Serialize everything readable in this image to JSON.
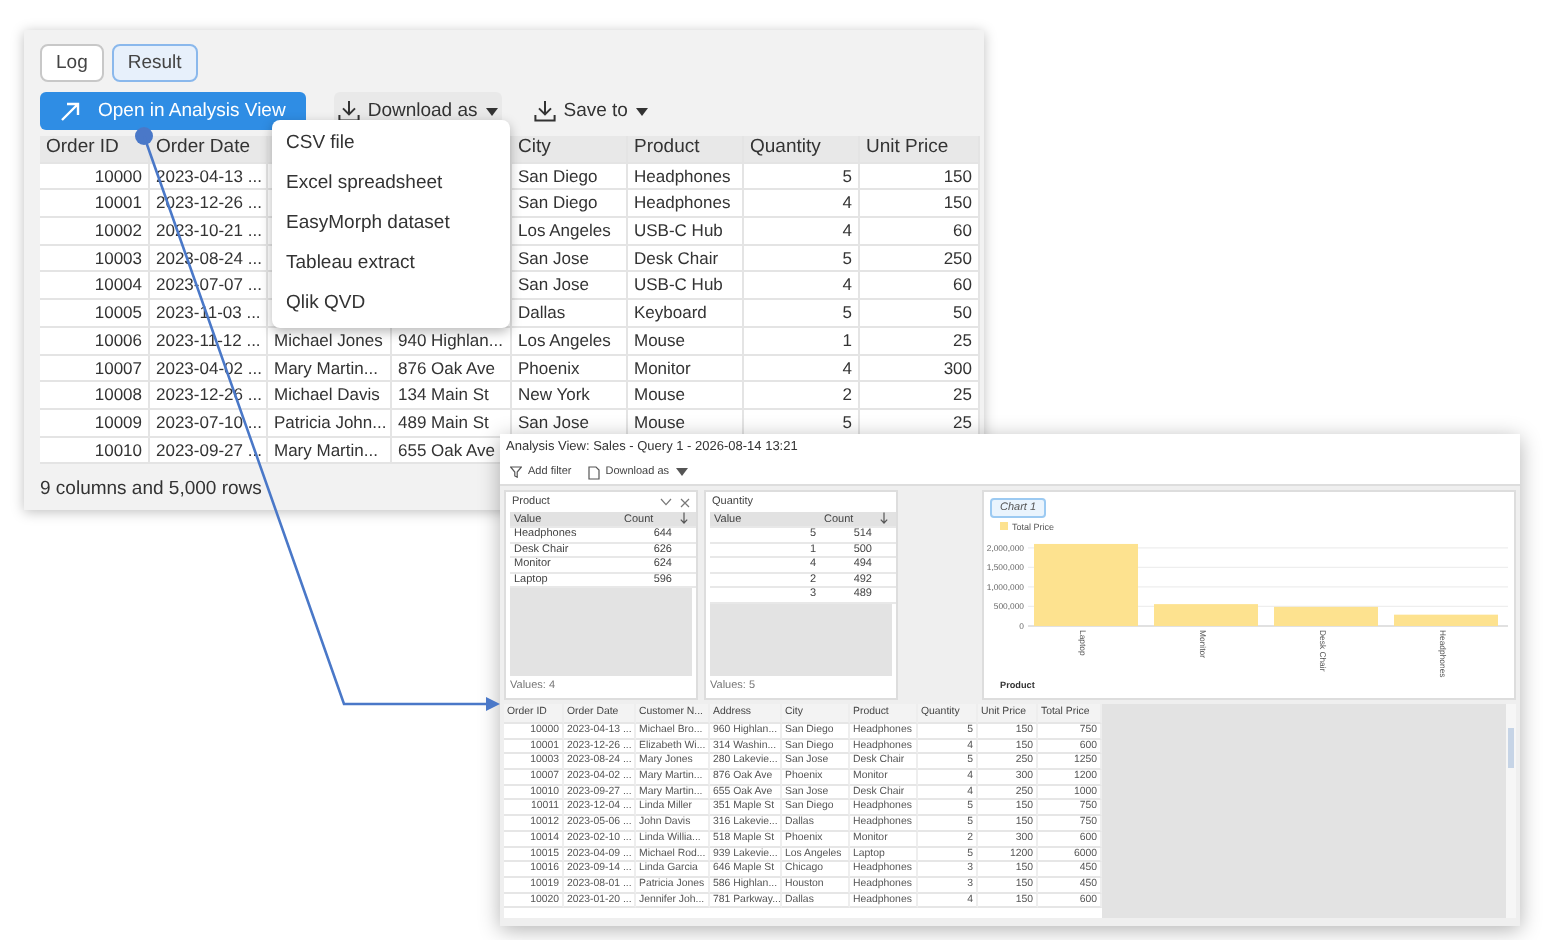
{
  "main": {
    "tabs": [
      {
        "label": "Log",
        "selected": false
      },
      {
        "label": "Result",
        "selected": true
      }
    ],
    "toolbar": {
      "open_button": "Open in Analysis View",
      "download": {
        "label": "Download as",
        "expanded": true,
        "menu": [
          "CSV file",
          "Excel spreadsheet",
          "EasyMorph dataset",
          "Tableau extract",
          "Qlik QVD"
        ]
      },
      "save": {
        "label": "Save to"
      }
    },
    "table": {
      "columns": [
        "Order ID",
        "Order Date",
        null,
        null,
        "City",
        "Product",
        "Quantity",
        "Unit Price"
      ],
      "rows": [
        [
          "10000",
          "2023-04-13 ...",
          null,
          null,
          "San Diego",
          "Headphones",
          "5",
          "150"
        ],
        [
          "10001",
          "2023-12-26 ...",
          null,
          null,
          "San Diego",
          "Headphones",
          "4",
          "150"
        ],
        [
          "10002",
          "2023-10-21 ...",
          null,
          null,
          "Los Angeles",
          "USB-C Hub",
          "4",
          "60"
        ],
        [
          "10003",
          "2023-08-24 ...",
          null,
          null,
          "San Jose",
          "Desk Chair",
          "5",
          "250"
        ],
        [
          "10004",
          "2023-07-07 ...",
          null,
          null,
          "San Jose",
          "USB-C Hub",
          "4",
          "60"
        ],
        [
          "10005",
          "2023-11-03 ...",
          null,
          null,
          "Dallas",
          "Keyboard",
          "5",
          "50"
        ],
        [
          "10006",
          "2023-11-12 ...",
          "Michael Jones",
          "940 Highlan...",
          "Los Angeles",
          "Mouse",
          "1",
          "25"
        ],
        [
          "10007",
          "2023-04-02 ...",
          "Mary Martin...",
          "876 Oak Ave",
          "Phoenix",
          "Monitor",
          "4",
          "300"
        ],
        [
          "10008",
          "2023-12-26 ...",
          "Michael Davis",
          "134 Main St",
          "New York",
          "Mouse",
          "2",
          "25"
        ],
        [
          "10009",
          "2023-07-10 ...",
          "Patricia John...",
          "489 Main St",
          "San Jose",
          "Mouse",
          "5",
          "25"
        ],
        [
          "10010",
          "2023-09-27 ...",
          "Mary Martin...",
          "655 Oak Ave"
        ]
      ]
    },
    "status_bar": "9 columns and 5,000 rows"
  },
  "analysis_window": {
    "title": "Analysis View: Sales - Query 1 - 2026-08-14 13:21",
    "toolbar": {
      "add_filter": "Add filter",
      "download": "Download as"
    },
    "filters": [
      {
        "title": "Product",
        "closable": true,
        "columns": [
          "Value",
          "Count"
        ],
        "rows": [
          [
            "Headphones",
            "644"
          ],
          [
            "Desk Chair",
            "626"
          ],
          [
            "Monitor",
            "624"
          ],
          [
            "Laptop",
            "596"
          ]
        ],
        "footer": "Values: 4"
      },
      {
        "title": "Quantity",
        "closable": false,
        "columns": [
          "Value",
          "Count"
        ],
        "rows": [
          [
            "5",
            "514"
          ],
          [
            "1",
            "500"
          ],
          [
            "4",
            "494"
          ],
          [
            "2",
            "492"
          ],
          [
            "3",
            "489"
          ]
        ],
        "footer": "Values: 5"
      }
    ],
    "chart": {
      "tab": {
        "label": "Chart 1",
        "selected": true
      },
      "chart_data": {
        "type": "bar",
        "categories": [
          "Laptop",
          "Monitor",
          "Desk Chair",
          "Headphones"
        ],
        "series": [
          {
            "name": "Total Price",
            "color": "#fde28f",
            "values": [
              2100000,
              560000,
              490000,
              290000
            ]
          }
        ],
        "xlabel": "Product",
        "grid": true,
        "ylim": [
          0,
          2150000
        ],
        "yticks": [
          0,
          {
            "value": 500000,
            "label": "500,000"
          },
          {
            "value": 1000000,
            "label": "1,000,000"
          },
          {
            "value": 1500000,
            "label": "1,500,000"
          },
          {
            "value": 2000000,
            "label": "2,000,000"
          }
        ]
      }
    },
    "table": {
      "columns": [
        "Order ID",
        "Order Date",
        "Customer N...",
        "Address",
        "City",
        "Product",
        "Quantity",
        "Unit Price",
        "Total Price"
      ],
      "rows": [
        [
          "10000",
          "2023-04-13 ...",
          "Michael Bro...",
          "960 Highlan...",
          "San Diego",
          "Headphones",
          "5",
          "150",
          "750"
        ],
        [
          "10001",
          "2023-12-26 ...",
          "Elizabeth Wi...",
          "314 Washin...",
          "San Diego",
          "Headphones",
          "4",
          "150",
          "600"
        ],
        [
          "10003",
          "2023-08-24 ...",
          "Mary Jones",
          "280 Lakevie...",
          "San Jose",
          "Desk Chair",
          "5",
          "250",
          "1250"
        ],
        [
          "10007",
          "2023-04-02 ...",
          "Mary Martin...",
          "876 Oak Ave",
          "Phoenix",
          "Monitor",
          "4",
          "300",
          "1200"
        ],
        [
          "10010",
          "2023-09-27 ...",
          "Mary Martin...",
          "655 Oak Ave",
          "San Jose",
          "Desk Chair",
          "4",
          "250",
          "1000"
        ],
        [
          "10011",
          "2023-12-04 ...",
          "Linda Miller",
          "351 Maple St",
          "San Diego",
          "Headphones",
          "5",
          "150",
          "750"
        ],
        [
          "10012",
          "2023-05-06 ...",
          "John Davis",
          "316 Lakevie...",
          "Dallas",
          "Headphones",
          "5",
          "150",
          "750"
        ],
        [
          "10014",
          "2023-02-10 ...",
          "Linda Willia...",
          "518 Maple St",
          "Phoenix",
          "Monitor",
          "2",
          "300",
          "600"
        ],
        [
          "10015",
          "2023-04-09 ...",
          "Michael Rod...",
          "939 Lakevie...",
          "Los Angeles",
          "Laptop",
          "5",
          "1200",
          "6000"
        ],
        [
          "10016",
          "2023-09-14 ...",
          "Linda Garcia",
          "646 Maple St",
          "Chicago",
          "Headphones",
          "3",
          "150",
          "450"
        ],
        [
          "10019",
          "2023-08-01 ...",
          "Patricia Jones",
          "586 Highlan...",
          "Houston",
          "Headphones",
          "3",
          "150",
          "450"
        ],
        [
          "10020",
          "2023-01-20 ...",
          "Jennifer Joh...",
          "781 Parkway...",
          "Dallas",
          "Headphones",
          "4",
          "150",
          "600"
        ]
      ]
    }
  }
}
